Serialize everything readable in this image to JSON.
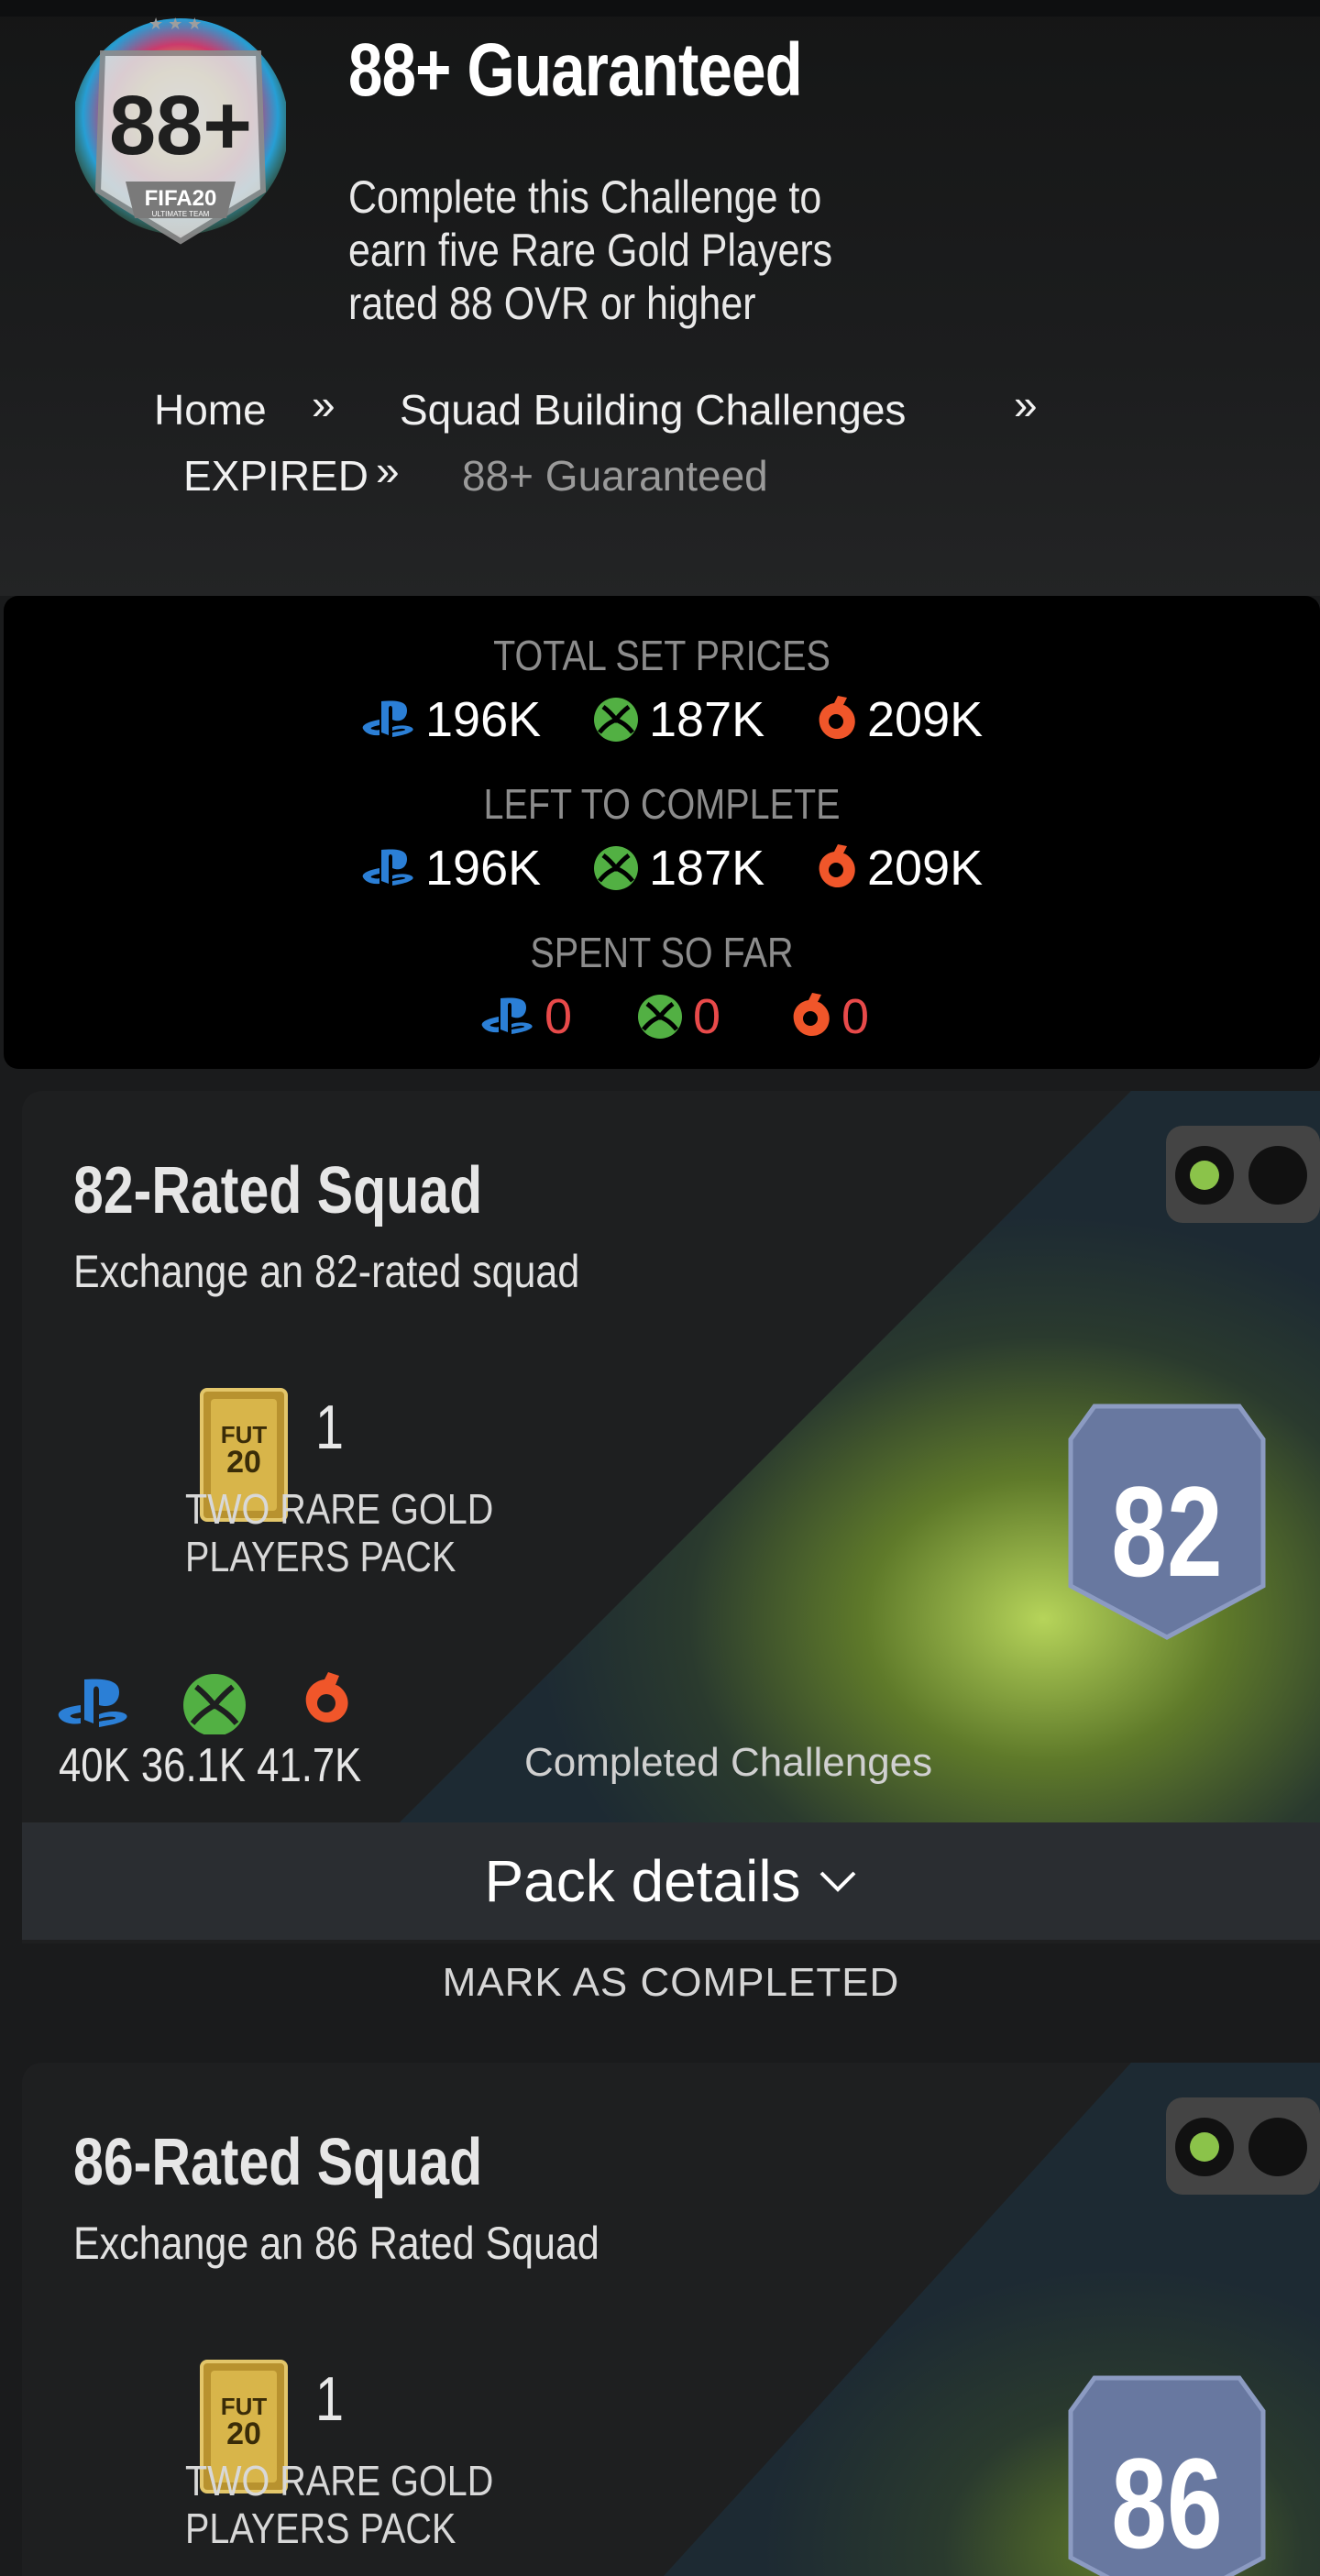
{
  "header": {
    "badge_number": "88+",
    "badge_caption": "FIFA20",
    "badge_subcaption": "ULTIMATE TEAM",
    "title": "88+ Guaranteed",
    "subtitle": "Complete this Challenge to earn five Rare Gold Players rated 88 OVR or higher"
  },
  "breadcrumb": {
    "home": "Home",
    "sbc": "Squad Building Challenges",
    "expired": "EXPIRED",
    "current": "88+ Guaranteed",
    "separator": "»"
  },
  "prices": {
    "total_label": "TOTAL SET PRICES",
    "total": {
      "ps": "196K",
      "xbox": "187K",
      "pc": "209K"
    },
    "left_label": "LEFT TO COMPLETE",
    "left": {
      "ps": "196K",
      "xbox": "187K",
      "pc": "209K"
    },
    "spent_label": "SPENT SO FAR",
    "spent": {
      "ps": "0",
      "xbox": "0",
      "pc": "0"
    }
  },
  "challenges": [
    {
      "title": "82-Rated Squad",
      "description": "Exchange an 82-rated squad",
      "pack_count": "1",
      "pack_name": "TWO RARE GOLD PLAYERS PACK",
      "pack_label": "FUT 20",
      "rating": "82",
      "price_ps": "40K",
      "price_xbox": "36.1K",
      "price_pc": "41.7K",
      "completed_label": "Completed Challenges",
      "pack_details_label": "Pack details",
      "mark_label": "MARK AS COMPLETED"
    },
    {
      "title": "86-Rated Squad",
      "description": "Exchange an 86 Rated Squad",
      "pack_count": "1",
      "pack_name": "TWO RARE GOLD PLAYERS PACK",
      "pack_label": "FUT 20",
      "rating": "86"
    }
  ],
  "colors": {
    "playstation": "#2b7fd6",
    "xbox": "#52b043",
    "origin": "#f0562a",
    "spent_value": "#e84a4a",
    "toggle_active": "#8bc34a",
    "rating_shield": "#6878a0"
  },
  "icons": [
    "playstation-icon",
    "xbox-icon",
    "origin-icon",
    "chevron-down-icon",
    "fut-pack-icon",
    "rating-shield-icon",
    "toggle-dot"
  ]
}
